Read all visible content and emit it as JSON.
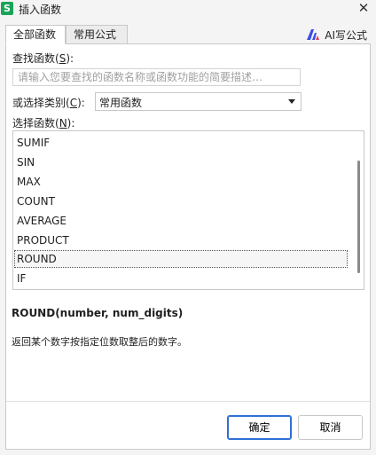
{
  "window": {
    "app_icon": "S",
    "title": "插入函数",
    "close": "✕"
  },
  "tabs": [
    {
      "label": "全部函数",
      "active": true
    },
    {
      "label": "常用公式",
      "active": false
    }
  ],
  "ai_button": {
    "label": "AI写公式",
    "icon": "ai-logo-icon"
  },
  "search": {
    "label_prefix": "查找函数(",
    "label_key": "S",
    "label_suffix": "):",
    "placeholder": "请输入您要查找的函数名称或函数功能的简要描述…"
  },
  "category": {
    "label_prefix": "或选择类别(",
    "label_key": "C",
    "label_suffix": "):",
    "value": "常用函数"
  },
  "function_list": {
    "label_prefix": "选择函数(",
    "label_key": "N",
    "label_suffix": "):",
    "items": [
      "SUMIF",
      "SIN",
      "MAX",
      "COUNT",
      "AVERAGE",
      "PRODUCT",
      "ROUND",
      "IF"
    ],
    "selected": "ROUND"
  },
  "signature": "ROUND(number, num_digits)",
  "description": "返回某个数字按指定位数取整后的数字。",
  "buttons": {
    "ok": "确定",
    "cancel": "取消"
  },
  "colors": {
    "app_icon": "#1ba35a",
    "ok_border": "#2f6fd6"
  }
}
